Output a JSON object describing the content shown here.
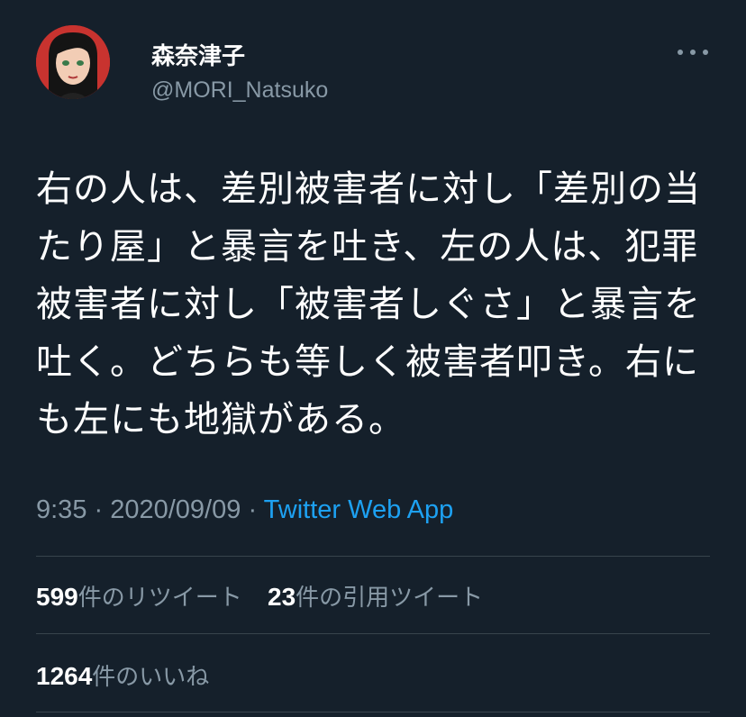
{
  "author": {
    "display_name": "森奈津子",
    "handle": "@MORI_Natsuko"
  },
  "more_icon": "more-horizontal-icon",
  "tweet": {
    "text": "右の人は、差別被害者に対し「差別の当たり屋」と暴言を吐き、左の人は、犯罪被害者に対し「被害者しぐさ」と暴言を吐く。どちらも等しく被害者叩き。右にも左にも地獄がある。",
    "time": "9:35",
    "separator": " · ",
    "date": "2020/09/09",
    "source": "Twitter Web App"
  },
  "stats": {
    "retweets_count": "599",
    "retweets_label": "件のリツイート",
    "quotes_count": "23",
    "quotes_label": "件の引用ツイート",
    "likes_count": "1264",
    "likes_label": "件のいいね"
  },
  "colors": {
    "background": "#15202b",
    "secondary_text": "#8899a6",
    "link": "#1da1f2",
    "divider": "#38444d"
  }
}
